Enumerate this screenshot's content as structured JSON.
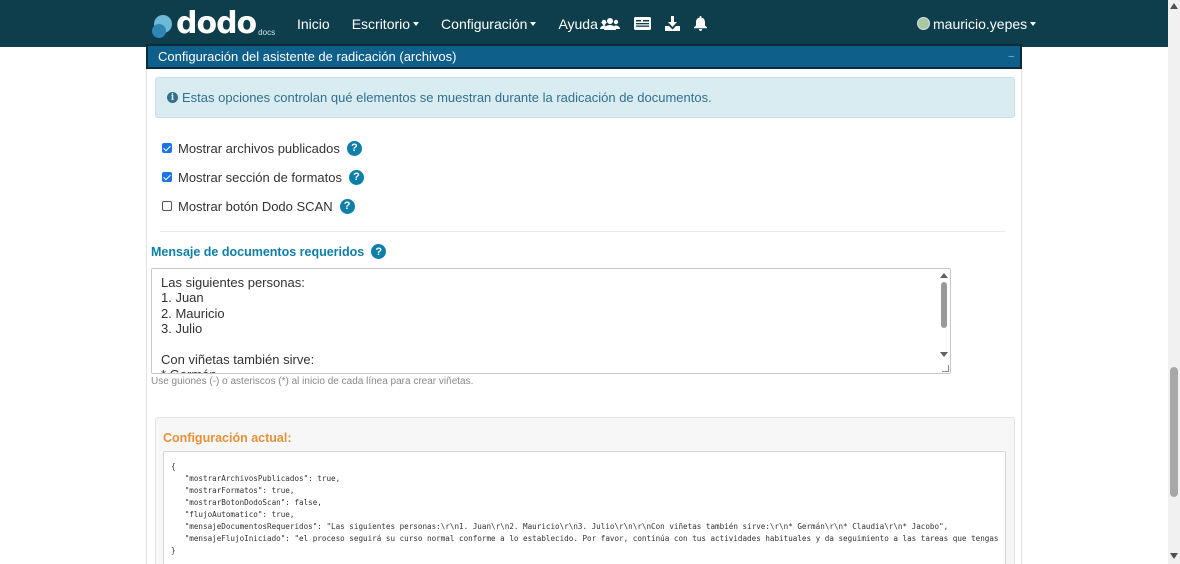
{
  "app": {
    "logo_text": "dodo",
    "logo_sub": "docs"
  },
  "nav": {
    "items": [
      {
        "label": "Inicio",
        "dropdown": false
      },
      {
        "label": "Escritorio",
        "dropdown": true
      },
      {
        "label": "Configuración",
        "dropdown": true
      },
      {
        "label": "Ayuda",
        "dropdown": true
      }
    ],
    "icons": [
      "users-icon",
      "id-card-icon",
      "download-icon",
      "bell-icon"
    ],
    "user": "mauricio.yepes"
  },
  "panel": {
    "title": "Configuración del asistente de radicación (archivos)",
    "collapse_symbol": "–"
  },
  "alert": {
    "icon": "info-icon",
    "text": "Estas opciones controlan qué elementos se muestran durante la radicación de documentos."
  },
  "options": [
    {
      "label": "Mostrar archivos publicados",
      "checked": true
    },
    {
      "label": "Mostrar sección de formatos",
      "checked": true
    },
    {
      "label": "Mostrar botón Dodo SCAN",
      "checked": false
    }
  ],
  "help_symbol": "?",
  "required_docs": {
    "label": "Mensaje de documentos requeridos",
    "value": "Las siguientes personas:\n1. Juan\n2. Mauricio\n3. Julio\n\nCon viñetas también sirve:\n* Germán",
    "hint": "Use guiones (-) o asteriscos (*) al inicio de cada línea para crear viñetas."
  },
  "current_config": {
    "title": "Configuración actual:",
    "json_text": "{\n   \"mostrarArchivosPublicados\": true,\n   \"mostrarFormatos\": true,\n   \"mostrarBotonDodoScan\": false,\n   \"flujoAutomatico\": true,\n   \"mensajeDocumentosRequeridos\": \"Las siguientes personas:\\r\\n1. Juan\\r\\n2. Mauricio\\r\\n3. Julio\\r\\n\\r\\nCon viñetas también sirve:\\r\\n* Germán\\r\\n* Claudia\\r\\n* Jacobo\",\n   \"mensajeFlujoIniciado\": \"el proceso seguirá su curso normal conforme a lo establecido. Por favor, continúa con tus actividades habituales y da seguimiento a las tareas que tengas\n}"
  },
  "colors": {
    "navbar": "#0e3d4c",
    "panel_header": "#0e5f8a",
    "accent": "#0e7fa8",
    "config_title": "#e8903a",
    "alert_bg": "#d9ecf2"
  }
}
